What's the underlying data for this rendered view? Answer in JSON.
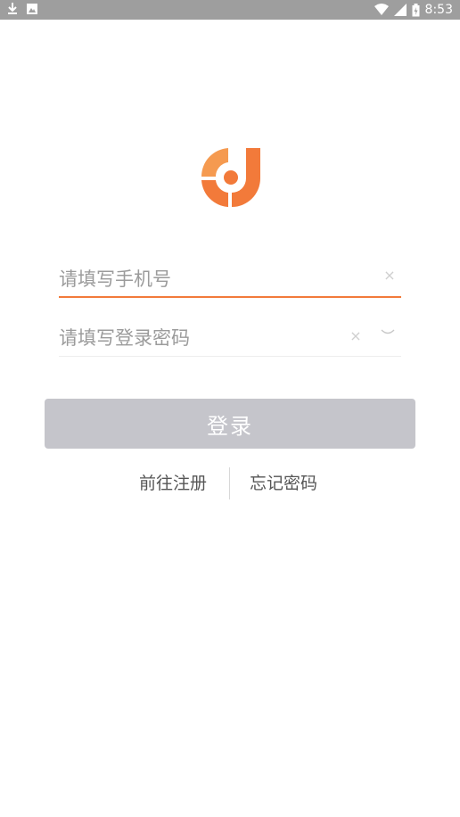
{
  "status_bar": {
    "time": "8:53",
    "icons": [
      "download-icon",
      "image-icon",
      "wifi-icon",
      "signal-icon",
      "battery-icon"
    ]
  },
  "logo": {
    "name": "app-logo",
    "colors": {
      "primary": "#f27a3a",
      "secondary": "#f59a50"
    }
  },
  "form": {
    "phone": {
      "placeholder": "请填写手机号",
      "value": ""
    },
    "password": {
      "placeholder": "请填写登录密码",
      "value": ""
    },
    "clear_icon": "×"
  },
  "login_button": {
    "label": "登录",
    "color": "#c5c5cb"
  },
  "links": {
    "register": "前往注册",
    "forgot_password": "忘记密码"
  },
  "colors": {
    "accent": "#f27a3a",
    "placeholder": "#9b9b9b",
    "status_bar": "#9e9e9e"
  }
}
